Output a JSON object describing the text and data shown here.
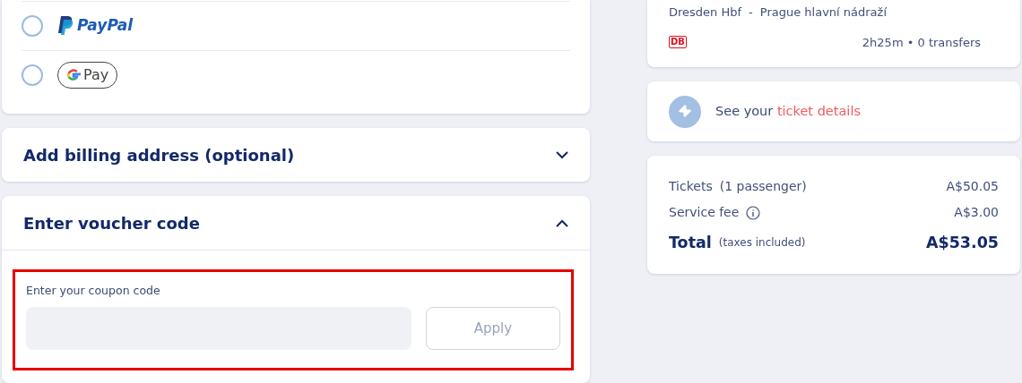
{
  "payment_methods": [
    {
      "kind": "paypal",
      "label": "PayPal",
      "selected": false
    },
    {
      "kind": "gpay",
      "label": "Pay",
      "selected": false
    }
  ],
  "sections": [
    {
      "title": "Add billing address (optional)",
      "expanded": false
    },
    {
      "title": "Enter voucher code",
      "expanded": true,
      "coupon": {
        "label": "Enter your coupon code",
        "button": "Apply",
        "button_disabled": true
      }
    }
  ],
  "trip": {
    "route_from": "Dresden Hbf",
    "route_sep": "-",
    "route_to": "Prague hlavní nádraží",
    "operator": "DB",
    "duration": "2h25m • 0 transfers"
  },
  "ticket_link": {
    "prefix": "See your",
    "link": "ticket details"
  },
  "summary": [
    {
      "kind": "line",
      "label": "Tickets",
      "note": "(1 passenger)",
      "amount": "A$50.05",
      "info": false
    },
    {
      "kind": "line",
      "label": "Service fee",
      "amount": "A$3.00",
      "info": true
    },
    {
      "kind": "total",
      "label": "Total",
      "note": "(taxes included)",
      "amount": "A$53.05",
      "info": false
    }
  ]
}
